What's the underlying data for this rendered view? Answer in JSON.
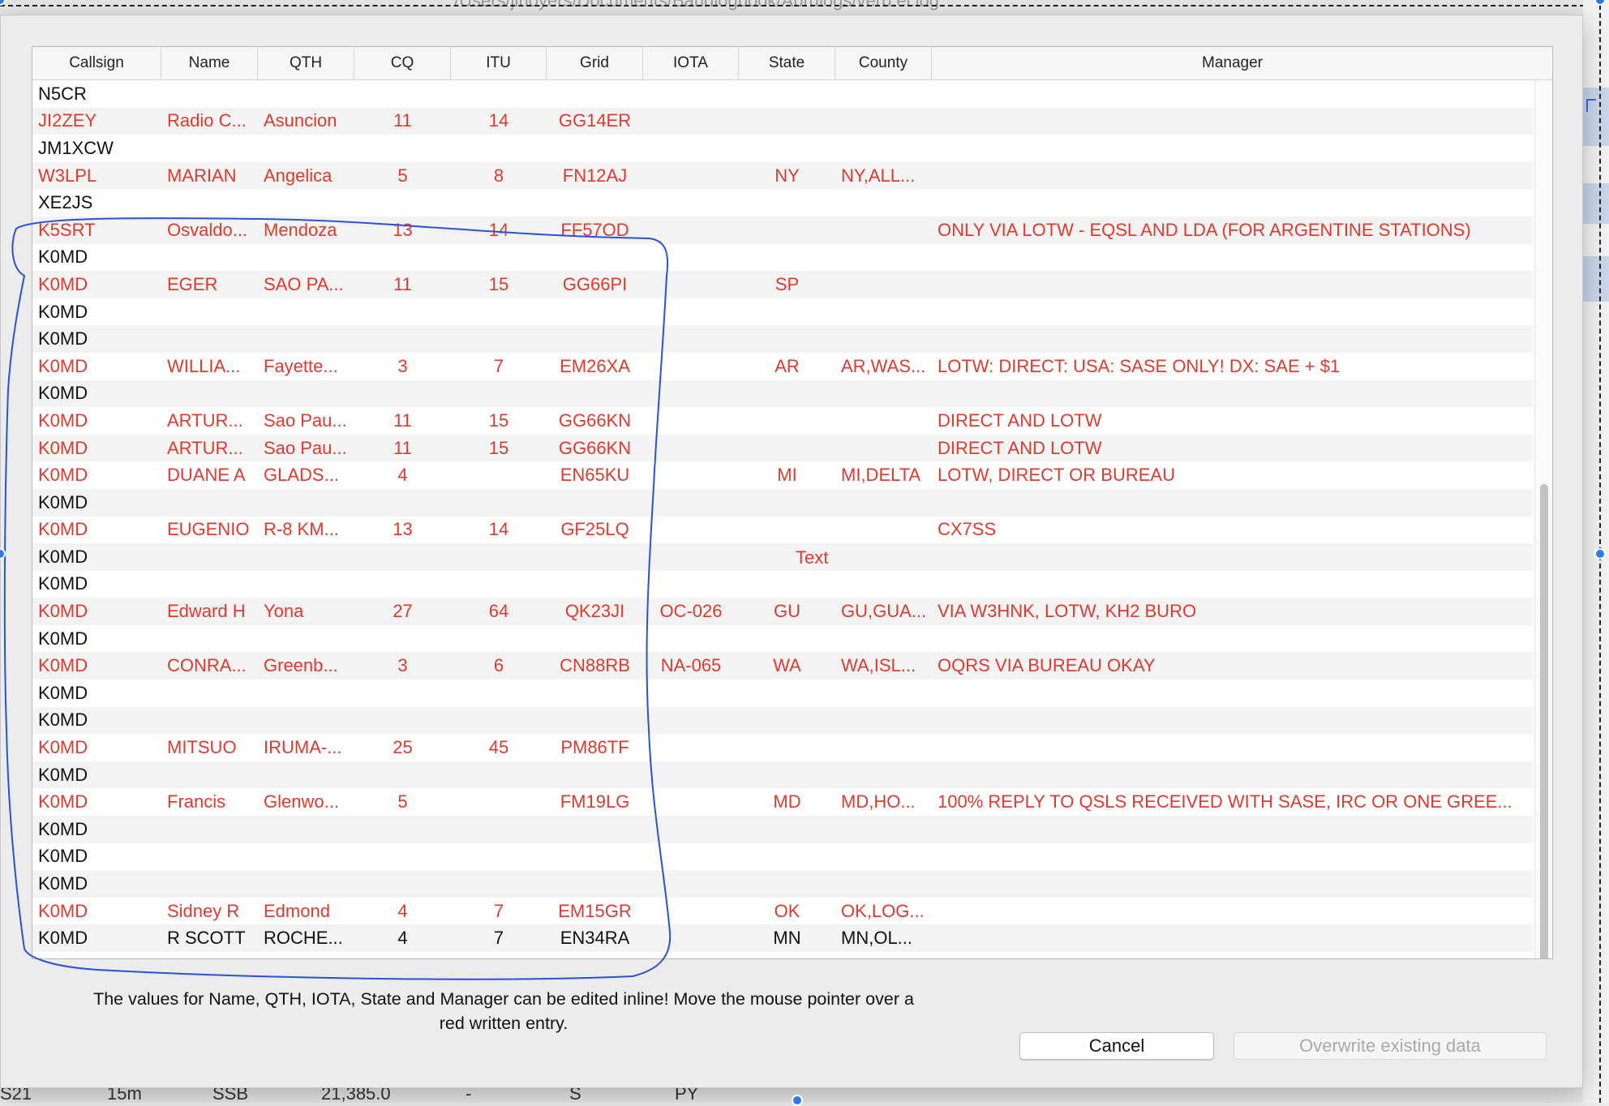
{
  "background": {
    "top_path": "/Users/jlnoyers/Documents/Bandlogbook/Abrdlogs/verb.el.log",
    "bottom_row": [
      "S21",
      "15m",
      "SSB",
      "21,385.0",
      "-",
      "S",
      "PY"
    ]
  },
  "columns": [
    "Callsign",
    "Name",
    "QTH",
    "CQ",
    "ITU",
    "Grid",
    "IOTA",
    "State",
    "County",
    "Manager"
  ],
  "rows": [
    {
      "red": false,
      "cells": [
        "N5CR",
        "",
        "",
        "",
        "",
        "",
        "",
        "",
        "",
        ""
      ]
    },
    {
      "red": true,
      "cells": [
        "JI2ZEY",
        "Radio C...",
        "Asuncion",
        "11",
        "14",
        "GG14ER",
        "",
        "",
        "",
        ""
      ]
    },
    {
      "red": false,
      "cells": [
        "JM1XCW",
        "",
        "",
        "",
        "",
        "",
        "",
        "",
        "",
        ""
      ]
    },
    {
      "red": true,
      "cells": [
        "W3LPL",
        "MARIAN",
        "Angelica",
        "5",
        "8",
        "FN12AJ",
        "",
        "NY",
        "NY,ALL...",
        ""
      ]
    },
    {
      "red": false,
      "cells": [
        "XE2JS",
        "",
        "",
        "",
        "",
        "",
        "",
        "",
        "",
        ""
      ]
    },
    {
      "red": true,
      "cells": [
        "K5SRT",
        "Osvaldo...",
        "Mendoza",
        "13",
        "14",
        "FF57OD",
        "",
        "",
        "",
        "ONLY VIA LOTW - EQSL AND LDA (FOR ARGENTINE STATIONS)"
      ]
    },
    {
      "red": false,
      "cells": [
        "K0MD",
        "",
        "",
        "",
        "",
        "",
        "",
        "",
        "",
        ""
      ]
    },
    {
      "red": true,
      "cells": [
        "K0MD",
        "EGER",
        "SAO PA...",
        "11",
        "15",
        "GG66PI",
        "",
        "SP",
        "",
        ""
      ]
    },
    {
      "red": false,
      "cells": [
        "K0MD",
        "",
        "",
        "",
        "",
        "",
        "",
        "",
        "",
        ""
      ]
    },
    {
      "red": false,
      "cells": [
        "K0MD",
        "",
        "",
        "",
        "",
        "",
        "",
        "",
        "",
        ""
      ]
    },
    {
      "red": true,
      "cells": [
        "K0MD",
        "WILLIA...",
        "Fayette...",
        "3",
        "7",
        "EM26XA",
        "",
        "AR",
        "AR,WAS...",
        "LOTW: DIRECT: USA: SASE ONLY! DX: SAE + $1"
      ]
    },
    {
      "red": false,
      "cells": [
        "K0MD",
        "",
        "",
        "",
        "",
        "",
        "",
        "",
        "",
        ""
      ]
    },
    {
      "red": true,
      "cells": [
        "K0MD",
        "ARTUR...",
        "Sao Pau...",
        "11",
        "15",
        "GG66KN",
        "",
        "",
        "",
        "DIRECT AND LOTW"
      ]
    },
    {
      "red": true,
      "cells": [
        "K0MD",
        "ARTUR...",
        "Sao Pau...",
        "11",
        "15",
        "GG66KN",
        "",
        "",
        "",
        "DIRECT AND LOTW"
      ]
    },
    {
      "red": true,
      "cells": [
        "K0MD",
        "DUANE A",
        "GLADS...",
        "4",
        "",
        "EN65KU",
        "",
        "MI",
        "MI,DELTA",
        "LOTW, DIRECT OR BUREAU"
      ]
    },
    {
      "red": false,
      "cells": [
        "K0MD",
        "",
        "",
        "",
        "",
        "",
        "",
        "",
        "",
        ""
      ]
    },
    {
      "red": true,
      "cells": [
        "K0MD",
        "EUGENIO",
        "R-8 KM...",
        "13",
        "14",
        "GF25LQ",
        "",
        "",
        "",
        "CX7SS"
      ]
    },
    {
      "red": false,
      "cells": [
        "K0MD",
        "",
        "",
        "",
        "",
        "",
        "",
        "",
        "",
        ""
      ]
    },
    {
      "red": false,
      "cells": [
        "K0MD",
        "",
        "",
        "",
        "",
        "",
        "",
        "",
        "",
        ""
      ]
    },
    {
      "red": true,
      "cells": [
        "K0MD",
        "Edward H",
        "Yona",
        "27",
        "64",
        "QK23JI",
        "OC-026",
        "GU",
        "GU,GUA...",
        "VIA W3HNK, LOTW, KH2 BURO"
      ]
    },
    {
      "red": false,
      "cells": [
        "K0MD",
        "",
        "",
        "",
        "",
        "",
        "",
        "",
        "",
        ""
      ]
    },
    {
      "red": true,
      "cells": [
        "K0MD",
        "CONRA...",
        "Greenb...",
        "3",
        "6",
        "CN88RB",
        "NA-065",
        "WA",
        "WA,ISL...",
        "OQRS VIA BUREAU OKAY"
      ]
    },
    {
      "red": false,
      "cells": [
        "K0MD",
        "",
        "",
        "",
        "",
        "",
        "",
        "",
        "",
        ""
      ]
    },
    {
      "red": false,
      "cells": [
        "K0MD",
        "",
        "",
        "",
        "",
        "",
        "",
        "",
        "",
        ""
      ]
    },
    {
      "red": true,
      "cells": [
        "K0MD",
        "MITSUO",
        "IRUMA-...",
        "25",
        "45",
        "PM86TF",
        "",
        "",
        "",
        ""
      ]
    },
    {
      "red": false,
      "cells": [
        "K0MD",
        "",
        "",
        "",
        "",
        "",
        "",
        "",
        "",
        ""
      ]
    },
    {
      "red": true,
      "cells": [
        "K0MD",
        "Francis",
        "Glenwo...",
        "5",
        "",
        "FM19LG",
        "",
        "MD",
        "MD,HO...",
        "100% REPLY TO QSLS RECEIVED WITH SASE, IRC OR ONE GREE..."
      ]
    },
    {
      "red": false,
      "cells": [
        "K0MD",
        "",
        "",
        "",
        "",
        "",
        "",
        "",
        "",
        ""
      ]
    },
    {
      "red": false,
      "cells": [
        "K0MD",
        "",
        "",
        "",
        "",
        "",
        "",
        "",
        "",
        ""
      ]
    },
    {
      "red": false,
      "cells": [
        "K0MD",
        "",
        "",
        "",
        "",
        "",
        "",
        "",
        "",
        ""
      ]
    },
    {
      "red": true,
      "cells": [
        "K0MD",
        "Sidney R",
        "Edmond",
        "4",
        "7",
        "EM15GR",
        "",
        "OK",
        "OK,LOG...",
        ""
      ]
    },
    {
      "red": false,
      "cells": [
        "K0MD",
        "R SCOTT",
        "ROCHE...",
        "4",
        "7",
        "EN34RA",
        "",
        "MN",
        "MN,OL...",
        ""
      ]
    }
  ],
  "overlay_text": "Text",
  "info_line1": "The values for Name, QTH, IOTA, State and Manager can be edited inline! Move the mouse pointer over a",
  "info_line2": "red written entry.",
  "buttons": {
    "cancel": "Cancel",
    "overwrite": "Overwrite existing data"
  },
  "colors": {
    "editable_text": "#e03a2e",
    "annotation_stroke": "#2a52d6",
    "selection_handle": "#2f7ae5"
  }
}
